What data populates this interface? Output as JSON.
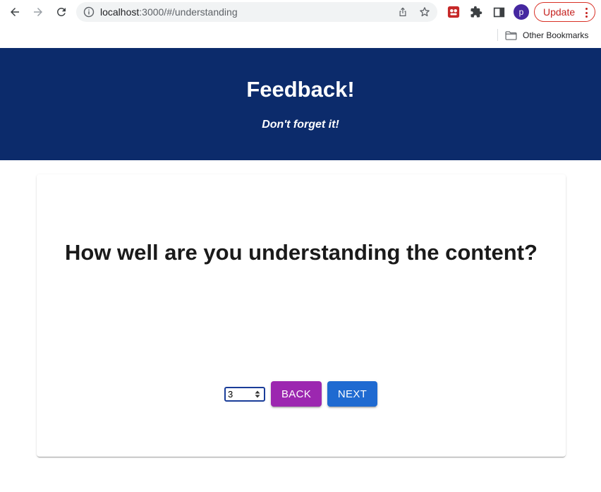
{
  "browser": {
    "url_host": "localhost",
    "url_rest": ":3000/#/understanding",
    "profile_initial": "p",
    "update_label": "Update",
    "bookmarks": {
      "other_label": "Other Bookmarks"
    }
  },
  "header": {
    "title": "Feedback!",
    "subtitle": "Don't forget it!"
  },
  "card": {
    "question": "How well are you understanding the content?",
    "rating_input": {
      "value": "3"
    },
    "back_label": "BACK",
    "next_label": "NEXT"
  },
  "colors": {
    "header_bg": "#0c2b6b",
    "back_button": "#9c27b0",
    "next_button": "#1f6ad1",
    "update_accent": "#c5221f"
  },
  "icons": [
    "back-arrow-icon",
    "forward-arrow-icon",
    "reload-icon",
    "site-info-icon",
    "share-icon",
    "bookmark-star-icon",
    "extension-icon",
    "puzzle-icon",
    "side-panel-icon",
    "more-vert-icon",
    "folder-icon",
    "spinner-arrows-icon"
  ]
}
